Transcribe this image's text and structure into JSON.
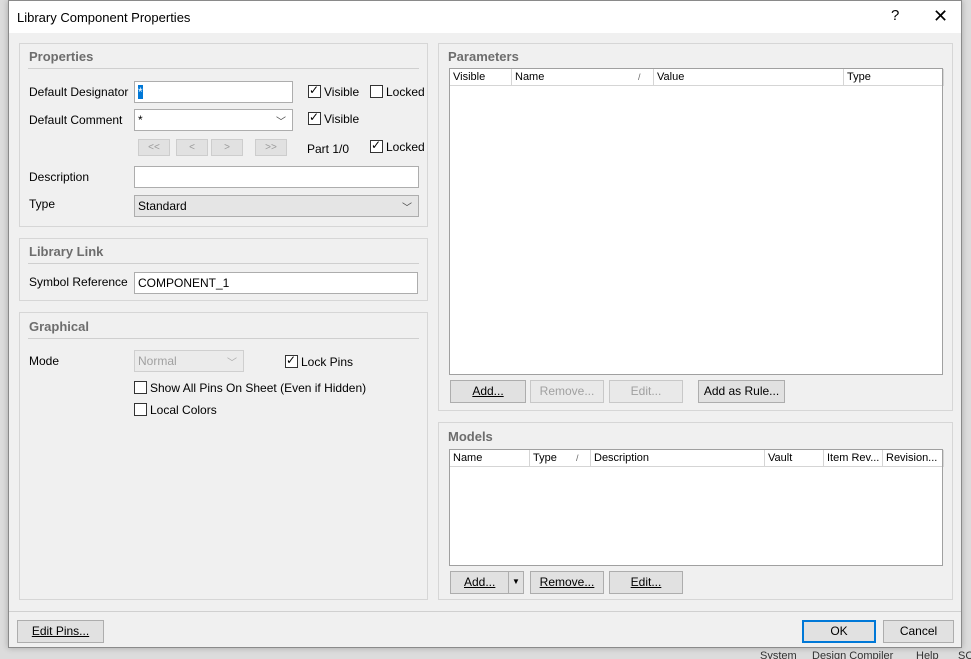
{
  "window": {
    "title": "Library Component Properties",
    "help": "?",
    "close": "✕"
  },
  "properties": {
    "title": "Properties",
    "designator_label": "Default Designator",
    "designator_value": "*",
    "comment_label": "Default Comment",
    "comment_value": "*",
    "visible_label": "Visible",
    "locked_label": "Locked",
    "nav": [
      "<<",
      "<",
      ">",
      ">>"
    ],
    "part_label": "Part 1/0",
    "description_label": "Description",
    "description_value": "",
    "type_label": "Type",
    "type_value": "Standard"
  },
  "library_link": {
    "title": "Library Link",
    "symbol_label": "Symbol Reference",
    "symbol_value": "COMPONENT_1"
  },
  "graphical": {
    "title": "Graphical",
    "mode_label": "Mode",
    "mode_value": "Normal",
    "lock_pins_label": "Lock Pins",
    "show_all_pins_label": "Show All Pins On Sheet (Even if Hidden)",
    "local_colors_label": "Local Colors"
  },
  "parameters": {
    "title": "Parameters",
    "columns": [
      "Visible",
      "Name",
      "Value",
      "Type"
    ],
    "buttons": {
      "add": "Add...",
      "remove": "Remove...",
      "edit": "Edit...",
      "add_rule": "Add as Rule..."
    }
  },
  "models": {
    "title": "Models",
    "columns": [
      "Name",
      "Type",
      "Description",
      "Vault",
      "Item Rev...",
      "Revision..."
    ],
    "buttons": {
      "add": "Add...",
      "remove": "Remove...",
      "edit": "Edit..."
    }
  },
  "footer": {
    "edit_pins": "Edit Pins...",
    "ok": "OK",
    "cancel": "Cancel"
  },
  "background": {
    "statusbar": [
      "System",
      "Design Compiler",
      "Help",
      "SC"
    ]
  }
}
